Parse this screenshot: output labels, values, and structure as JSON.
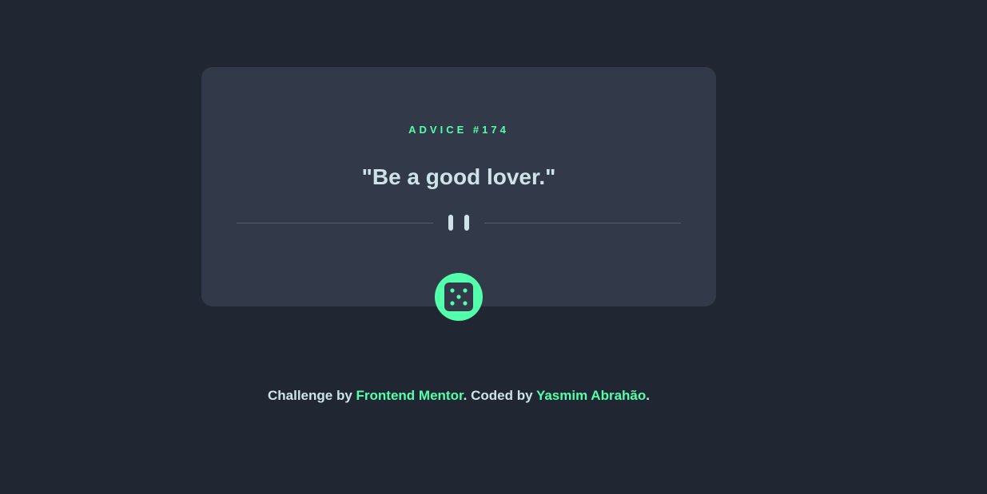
{
  "card": {
    "advice_label": "ADVICE",
    "advice_hash": "#",
    "advice_number": "174",
    "advice_text": "\"Be a good lover.\""
  },
  "icons": {
    "divider": "pause-icon",
    "dice": "dice-icon"
  },
  "footer": {
    "prefix": "Challenge by ",
    "challenge_link": "Frontend Mentor",
    "middle": ". Coded by ",
    "author_link": "Yasmim Abrahão",
    "suffix": "."
  },
  "colors": {
    "background": "#202632",
    "card": "#323a49",
    "accent": "#53ffaa",
    "text": "#cee3e9",
    "divider": "#4f5d74"
  }
}
